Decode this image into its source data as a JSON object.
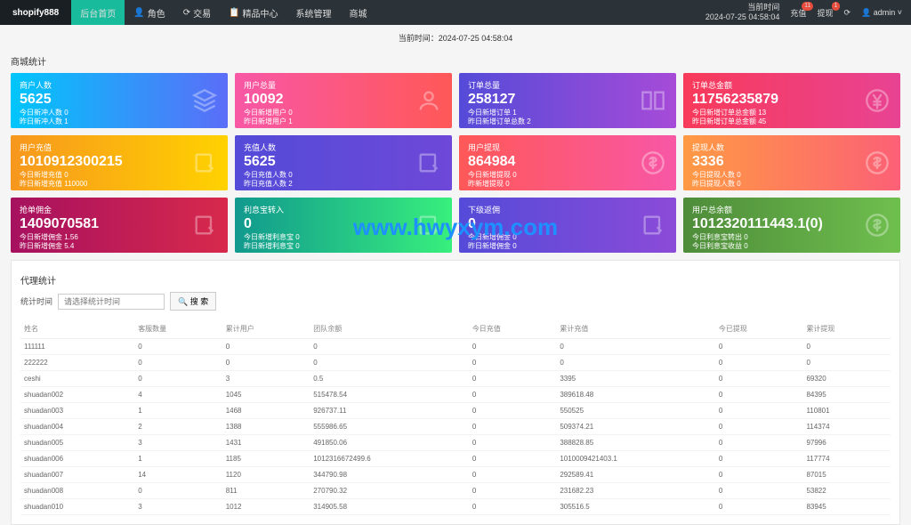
{
  "header": {
    "brand": "shopify888",
    "nav": [
      "后台首页",
      "角色",
      "交易",
      "精品中心",
      "系统管理",
      "商城"
    ],
    "nav_icons": [
      "",
      "👤",
      "⟳",
      "📋",
      "",
      ""
    ],
    "time_label": "当前时间",
    "time_value": "2024-07-25 04:58:04",
    "recharge": "充值",
    "recharge_badge": "11",
    "withdraw": "提现",
    "withdraw_badge": "1",
    "user": "admin"
  },
  "subhead": {
    "lbl": "当前时间：",
    "val": "2024-07-25 04:58:04"
  },
  "sectionTitle": "商城统计",
  "cards": [
    {
      "t": "商户人数",
      "v": "5625",
      "l1": "今日新冲人数 0",
      "l2": "昨日新冲人数 1",
      "g": "g1",
      "ico": "layers"
    },
    {
      "t": "用户总量",
      "v": "10092",
      "l1": "今日新增用户 0",
      "l2": "昨日新增用户 1",
      "g": "g2",
      "ico": "user"
    },
    {
      "t": "订单总量",
      "v": "258127",
      "l1": "今日新增订单 1",
      "l2": "昨日新增订单总数 2",
      "g": "g3",
      "ico": "book"
    },
    {
      "t": "订单总金额",
      "v": "11756235879",
      "l1": "今日新增订单总金额 13",
      "l2": "昨日新增订单总金额 45",
      "g": "g4",
      "ico": "yen"
    },
    {
      "t": "用户充值",
      "v": "1010912300215",
      "l1": "今日新增充值 0",
      "l2": "昨日新增充值 110000",
      "g": "g5",
      "ico": "edit"
    },
    {
      "t": "充值人数",
      "v": "5625",
      "l1": "今日充值人数 0",
      "l2": "昨日充值人数 2",
      "g": "g6",
      "ico": "edit"
    },
    {
      "t": "用户提现",
      "v": "864984",
      "l1": "今日新增提现 0",
      "l2": "昨新增提现 0",
      "g": "g7",
      "ico": "dollar"
    },
    {
      "t": "提现人数",
      "v": "3336",
      "l1": "今日提现人数 0",
      "l2": "昨日提现人数 0",
      "g": "g8",
      "ico": "dollar"
    },
    {
      "t": "抢单佣金",
      "v": "1409070581",
      "l1": "今日新增佣金 1.56",
      "l2": "昨日新增佣金 5.4",
      "g": "g9",
      "ico": "edit"
    },
    {
      "t": "利息宝转入",
      "v": "0",
      "l1": "今日新增利息宝 0",
      "l2": "昨日新增利息宝 0",
      "g": "g10",
      "ico": "edit"
    },
    {
      "t": "下级返佣",
      "v": "0",
      "l1": "今日新增佣金 0",
      "l2": "昨日新增佣金 0",
      "g": "g11",
      "ico": "edit"
    },
    {
      "t": "用户总余额",
      "v": "1012320111443.1(0)",
      "l1": "今日利息宝转出 0",
      "l2": "今日利息宝收益 0",
      "g": "g12",
      "ico": "dollar"
    }
  ],
  "agent": {
    "title": "代理统计",
    "filterLabel": "统计时间",
    "placeholder": "请选择统计时间",
    "searchBtn": "搜 索",
    "headers": [
      "姓名",
      "客服数量",
      "累计用户",
      "团队余额",
      "今日充值",
      "累计充值",
      "今已提现",
      "累计提现"
    ],
    "rows": [
      [
        "111111",
        "0",
        "0",
        "0",
        "0",
        "0",
        "0",
        "0"
      ],
      [
        "222222",
        "0",
        "0",
        "0",
        "0",
        "0",
        "0",
        "0"
      ],
      [
        "ceshi",
        "0",
        "3",
        "0.5",
        "0",
        "3395",
        "0",
        "69320"
      ],
      [
        "shuadan002",
        "4",
        "1045",
        "515478.54",
        "0",
        "389618.48",
        "0",
        "84395"
      ],
      [
        "shuadan003",
        "1",
        "1468",
        "926737.11",
        "0",
        "550525",
        "0",
        "110801"
      ],
      [
        "shuadan004",
        "2",
        "1388",
        "555986.65",
        "0",
        "509374.21",
        "0",
        "114374"
      ],
      [
        "shuadan005",
        "3",
        "1431",
        "491850.06",
        "0",
        "388828.85",
        "0",
        "97996"
      ],
      [
        "shuadan006",
        "1",
        "1185",
        "1012316672499.6",
        "0",
        "1010009421403.1",
        "0",
        "117774"
      ],
      [
        "shuadan007",
        "14",
        "1120",
        "344790.98",
        "0",
        "292589.41",
        "0",
        "87015"
      ],
      [
        "shuadan008",
        "0",
        "811",
        "270790.32",
        "0",
        "231682.23",
        "0",
        "53822"
      ],
      [
        "shuadan010",
        "3",
        "1012",
        "314905.58",
        "0",
        "305516.5",
        "0",
        "83945"
      ]
    ]
  },
  "watermark": "www.hwyxym.com"
}
